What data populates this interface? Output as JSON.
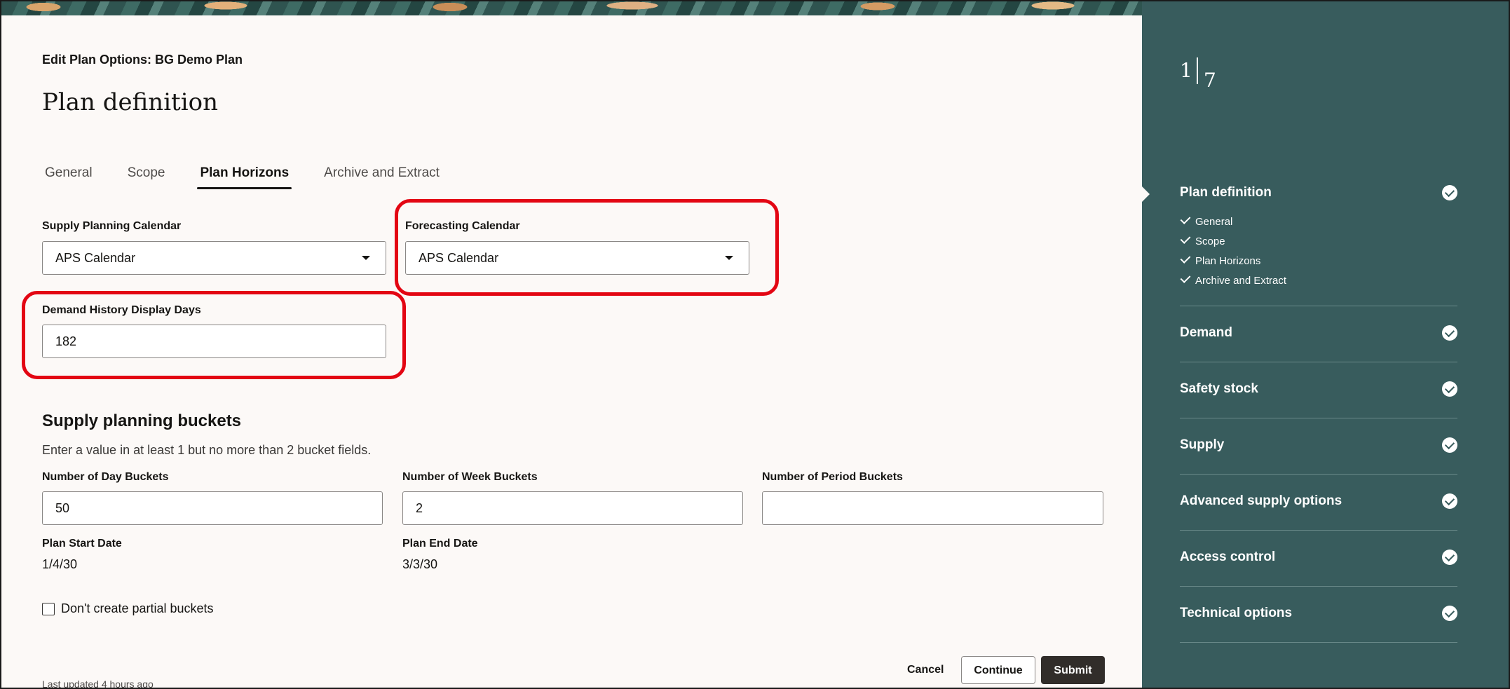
{
  "header": {
    "eyebrow": "Edit Plan Options: BG Demo Plan",
    "title": "Plan definition"
  },
  "tabs": [
    {
      "label": "General",
      "active": false
    },
    {
      "label": "Scope",
      "active": false
    },
    {
      "label": "Plan Horizons",
      "active": true
    },
    {
      "label": "Archive and Extract",
      "active": false
    }
  ],
  "form": {
    "supply_calendar": {
      "label": "Supply Planning Calendar",
      "value": "APS Calendar"
    },
    "forecast_calendar": {
      "label": "Forecasting Calendar",
      "value": "APS Calendar"
    },
    "demand_history": {
      "label": "Demand History Display Days",
      "value": "182"
    }
  },
  "buckets": {
    "title": "Supply planning buckets",
    "helper": "Enter a value in at least 1 but no more than 2 bucket fields.",
    "day": {
      "label": "Number of Day Buckets",
      "value": "50"
    },
    "week": {
      "label": "Number of Week Buckets",
      "value": "2"
    },
    "period": {
      "label": "Number of Period Buckets",
      "value": ""
    },
    "start": {
      "label": "Plan Start Date",
      "value": "1/4/30"
    },
    "end": {
      "label": "Plan End Date",
      "value": "3/3/30"
    },
    "partial_checkbox": {
      "label": "Don't create partial buckets",
      "checked": false
    }
  },
  "footer": {
    "last_updated": "Last updated 4 hours ago",
    "cancel": "Cancel",
    "continue": "Continue",
    "submit": "Submit"
  },
  "stepper": {
    "current": "1",
    "total": "7",
    "steps": [
      {
        "label": "Plan definition",
        "complete": true,
        "current": true,
        "substeps": [
          "General",
          "Scope",
          "Plan Horizons",
          "Archive and Extract"
        ]
      },
      {
        "label": "Demand",
        "complete": true
      },
      {
        "label": "Safety stock",
        "complete": true
      },
      {
        "label": "Supply",
        "complete": true
      },
      {
        "label": "Advanced supply options",
        "complete": true
      },
      {
        "label": "Access control",
        "complete": true
      },
      {
        "label": "Technical options",
        "complete": true
      }
    ]
  },
  "colors": {
    "sidebar": "#385c5d",
    "highlight": "#e30613",
    "primary_button": "#312d2a",
    "page_background": "#fcf9f7"
  }
}
